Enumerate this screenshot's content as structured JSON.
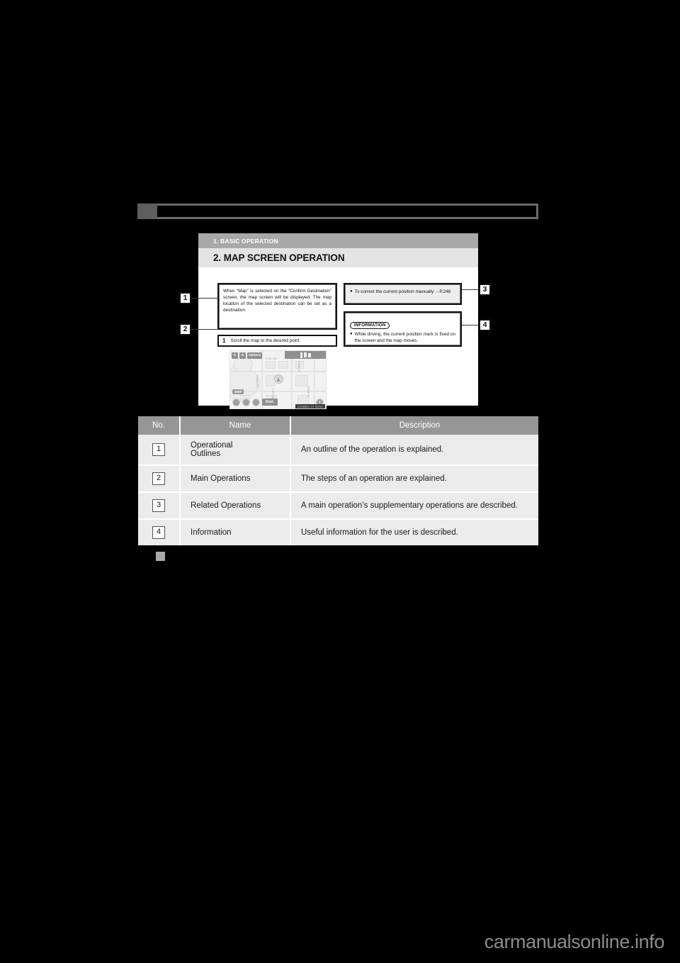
{
  "page": {
    "background_color": "#000000",
    "watermark": "carmanualsonline.info"
  },
  "figure": {
    "kicker": "1. BASIC OPERATION",
    "title": "2. MAP SCREEN OPERATION",
    "box1": {
      "text": "When “Map” is selected on the “Confirm Destination” screen, the map screen will be displayed. The map location of the selected destination can be set as a destination."
    },
    "box2": {
      "step_number": "1",
      "text": "Scroll the map to the desired point."
    },
    "box3": {
      "bullet": "●",
      "text": "To correct the current position manually:→P.246"
    },
    "box4": {
      "badge": "INFORMATION",
      "bullet": "●",
      "text": "While driving, the current position mark is fixed on the screen and the map moves."
    },
    "callouts": [
      {
        "number": "1"
      },
      {
        "number": "2"
      },
      {
        "number": "3"
      },
      {
        "number": "4"
      }
    ],
    "nav_screen": {
      "options_button": "Options",
      "compass_button": "N",
      "scale_label": "300ft",
      "dest_button": "Dest.",
      "info_button": "i",
      "corner_tag": "COMBO AT NAVI",
      "street_labels": [
        "E 1ST AVE",
        "N MAIN ST",
        "S 1ST AVE",
        "N OAK ST",
        "S ELM ST"
      ]
    }
  },
  "table": {
    "headers": [
      "No.",
      "Name",
      "Description"
    ],
    "rows": [
      {
        "no": "1",
        "name": "Operational\nOutlines",
        "description": "An outline of the operation is explained."
      },
      {
        "no": "2",
        "name": "Main Operations",
        "description": "The steps of an operation are explained."
      },
      {
        "no": "3",
        "name": "Related Operations",
        "description": "A main operation’s supplementary operations are described."
      },
      {
        "no": "4",
        "name": "Information",
        "description": "Useful information for the user is described."
      }
    ]
  },
  "colors": {
    "header_gray": "#969696",
    "row_gray": "#ebebeb",
    "kicker_gray": "#a8a8a8",
    "title_gray": "#e3e3e3"
  }
}
